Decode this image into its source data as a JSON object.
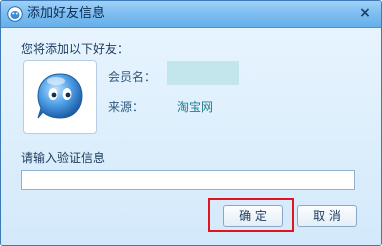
{
  "window": {
    "title": "添加好友信息",
    "close_glyph": "×",
    "icon": "qq-penguin-icon"
  },
  "heading": "您将添加以下好友：",
  "friend": {
    "member_name_label": "会员名：",
    "member_name_value": "",
    "source_label": "来源：",
    "source_value": "淘宝网",
    "avatar_icon": "aliwangwang-avatar-icon"
  },
  "verify": {
    "label": "请输入验证信息",
    "value": "",
    "placeholder": ""
  },
  "buttons": {
    "ok": "确 定",
    "cancel": "取 消"
  },
  "colors": {
    "title_bar": "#7cbdf0",
    "body_bg": "#dbeefc",
    "highlight": "#e0141c",
    "member_name_bg": "#c2e6ec",
    "source_text": "#1f7d8a"
  }
}
